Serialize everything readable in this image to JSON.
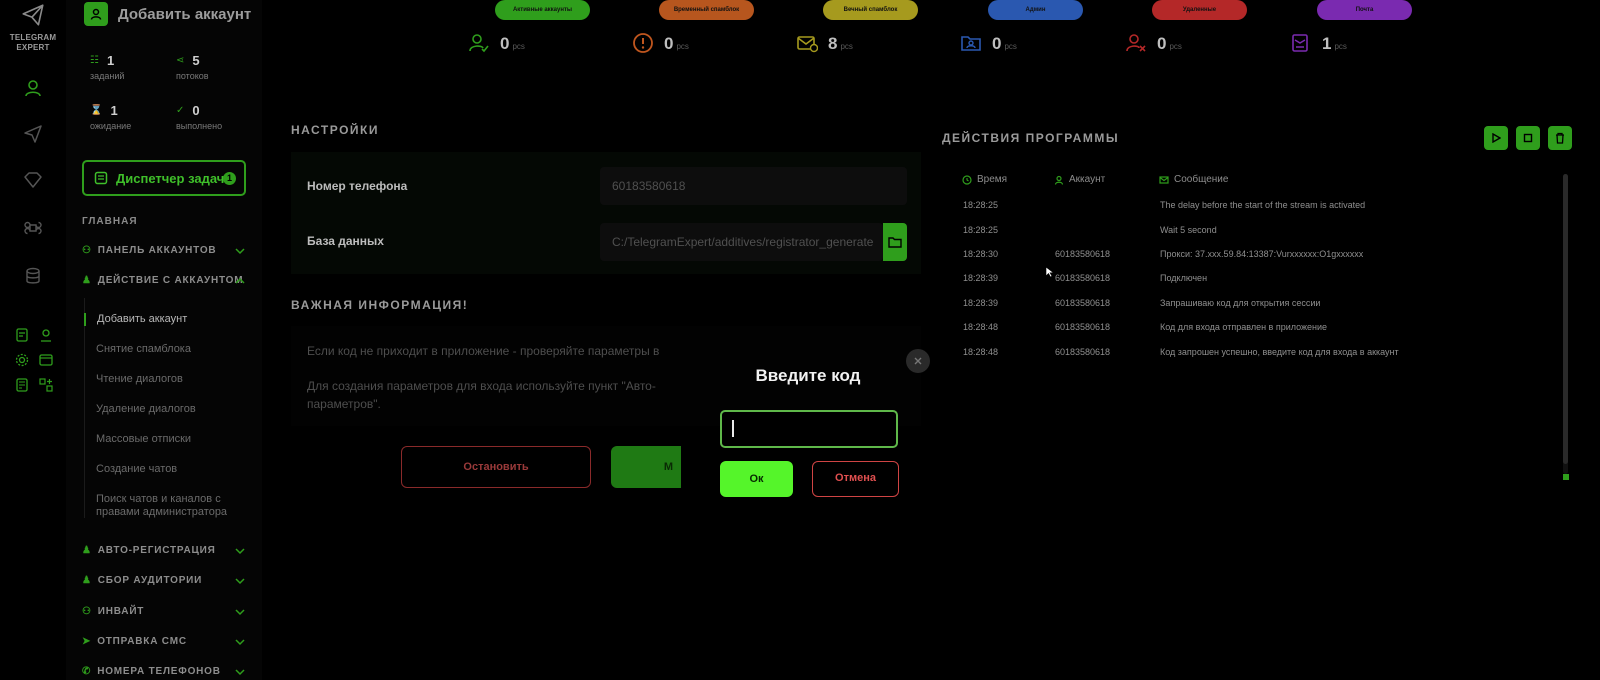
{
  "brand": {
    "line1": "TELEGRAM",
    "line2": "EXPERT"
  },
  "colors": {
    "accent": "#2f9e1c",
    "danger": "#d04444",
    "ok": "#55f52a"
  },
  "header": {
    "add_account": "Добавить аккаунт"
  },
  "stats": [
    {
      "value": "1",
      "label": "заданий"
    },
    {
      "value": "5",
      "label": "потоков"
    },
    {
      "value": "1",
      "label": "ожидание"
    },
    {
      "value": "0",
      "label": "выполнено"
    }
  ],
  "dispatcher": {
    "label": "Диспетчер задач",
    "badge": "1"
  },
  "sidebar": {
    "section_main": "ГЛАВНАЯ",
    "groups": [
      "ПАНЕЛЬ АККАУНТОВ",
      "ДЕЙСТВИЕ С АККАУНТОМ",
      "АВТО-РЕГИСТРАЦИЯ",
      "СБОР АУДИТОРИИ",
      "ИНВАЙТ",
      "ОТПРАВКА СМС",
      "НОМЕРА ТЕЛЕФОНОВ"
    ],
    "subitems": [
      "Добавить аккаунт",
      "Снятие спамблока",
      "Чтение диалогов",
      "Удаление диалогов",
      "Массовые отписки",
      "Создание чатов",
      "Поиск чатов и каналов с правами администратора"
    ]
  },
  "top_stats": [
    {
      "pill": "Активные аккаунты",
      "value": "0",
      "unit": "pcs",
      "color": "#2f9e1c"
    },
    {
      "pill": "Временный спамблок",
      "value": "0",
      "unit": "pcs",
      "color": "#b7561e"
    },
    {
      "pill": "Вечный спамблок",
      "value": "8",
      "unit": "pcs",
      "color": "#a69a1e"
    },
    {
      "pill": "Админ",
      "value": "0",
      "unit": "pcs",
      "color": "#2a58b0"
    },
    {
      "pill": "Удаленные",
      "value": "0",
      "unit": "pcs",
      "color": "#b42828"
    },
    {
      "pill": "Почта",
      "value": "1",
      "unit": "pcs",
      "color": "#7a2ab0"
    }
  ],
  "settings": {
    "title": "НАСТРОЙКИ",
    "phone_label": "Номер телефона",
    "phone_value": "60183580618",
    "db_label": "База данных",
    "db_value": "C:/TelegramExpert/additives/registrator_generate"
  },
  "info": {
    "title": "ВАЖНАЯ ИНФОРМАЦИЯ!",
    "line1": "Если код не приходит в приложение - проверяйте параметры в",
    "line2": "Для создания параметров для входа используйте пункт \"Авто-",
    "line3": "параметров\"."
  },
  "buttons": {
    "stop": "Остановить",
    "start_partial": "М"
  },
  "log": {
    "title": "ДЕЙСТВИЯ ПРОГРАММЫ",
    "col_time": "Время",
    "col_account": "Аккаунт",
    "col_message": "Сообщение",
    "rows": [
      {
        "time": "18:28:25",
        "account": "",
        "message": "The delay before the start of the stream is activated"
      },
      {
        "time": "18:28:25",
        "account": "",
        "message": "Wait 5 second"
      },
      {
        "time": "18:28:30",
        "account": "60183580618",
        "message": "Прокси: 37.xxx.59.84:13387:Vurxxxxxx:O1gxxxxxx"
      },
      {
        "time": "18:28:39",
        "account": "60183580618",
        "message": "Подключен"
      },
      {
        "time": "18:28:39",
        "account": "60183580618",
        "message": "Запрашиваю код для открытия сессии"
      },
      {
        "time": "18:28:48",
        "account": "60183580618",
        "message": "Код для входа отправлен в приложение"
      },
      {
        "time": "18:28:48",
        "account": "60183580618",
        "message": "Код запрошен успешно, введите код для входа в аккаунт"
      }
    ]
  },
  "modal": {
    "title": "Введите код",
    "input_value": "",
    "ok": "Ок",
    "cancel": "Отмена"
  }
}
